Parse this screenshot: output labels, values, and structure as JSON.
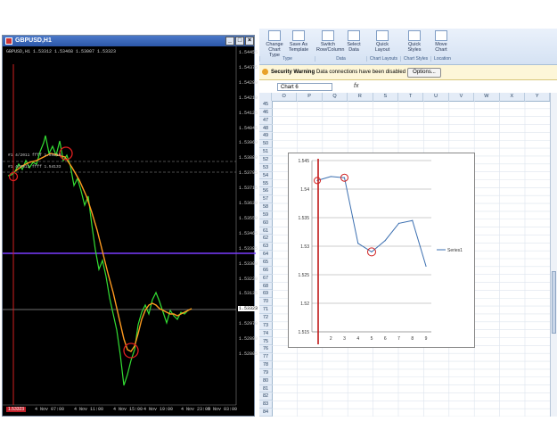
{
  "terminal": {
    "window_title": "GBPUSD,H1",
    "quote_line": "GBPUSD,H1 1.53312 1.53468 1.53007 1.53323",
    "price_labels": [
      "1.54455",
      "1.54290",
      "1.54125",
      "1.53960",
      "1.53795",
      "1.53630",
      "1.53465",
      "1.53300",
      "1.53135",
      "1.52970",
      "1.52805",
      "1.52640",
      "1.52475",
      "1.52310",
      "1.52145",
      "1.51980"
    ],
    "price_labels_display": [
      "1.54455",
      "1.54375",
      "1.54290",
      "1.54210",
      "1.54125",
      "1.54045",
      "1.53960",
      "1.53880",
      "1.53795",
      "1.53715",
      "1.53630",
      "1.53550",
      "1.53465",
      "1.53385",
      "1.53300",
      "1.53220",
      "1.53135",
      "1.53055",
      "1.52970",
      "1.52890",
      "1.52805"
    ],
    "time_labels": [
      "4 Nov 07:00",
      "4 Nov 11:00",
      "4 Nov 15:00",
      "4 Nov 19:00",
      "4 Nov 23:00",
      "5 Nov 03:00"
    ],
    "hline_labels": [
      "#1 4/2011 ffff 1.54210",
      "#1 4/2011 ffff 1.54133"
    ],
    "current_price": "1.53323",
    "bottom_tag": "1.53323",
    "colors": {
      "fast_line": "#33dd33",
      "slow_line": "#ff9a1f",
      "purple_line": "#7a3cff",
      "marker": "#e02020"
    }
  },
  "excel": {
    "ribbon": {
      "buttons": [
        {
          "label": "Change Chart Type",
          "icon": "change-chart-type-icon"
        },
        {
          "label": "Save As Template",
          "icon": "save-template-icon"
        },
        {
          "label": "Switch Row/Column",
          "icon": "switch-row-column-icon"
        },
        {
          "label": "Select Data",
          "icon": "select-data-icon"
        },
        {
          "label": "Quick Layout",
          "icon": "quick-layout-icon"
        },
        {
          "label": "Quick Styles",
          "icon": "quick-styles-icon"
        },
        {
          "label": "Move Chart",
          "icon": "move-chart-icon"
        }
      ],
      "groups": [
        "Type",
        "Data",
        "Chart Layouts",
        "Chart Styles",
        "Location"
      ]
    },
    "security": {
      "title": "Security Warning",
      "message": "Data connections have been disabled",
      "options_label": "Options..."
    },
    "name_box": "Chart 6",
    "fx_label": "fx",
    "columns": [
      "O",
      "P",
      "Q",
      "R",
      "S",
      "T",
      "U",
      "V",
      "W",
      "X",
      "Y"
    ],
    "rows": [
      "45",
      "46",
      "47",
      "48",
      "49",
      "50",
      "51",
      "52",
      "53",
      "54",
      "55",
      "56",
      "57",
      "58",
      "59",
      "60",
      "61",
      "62",
      "63",
      "64",
      "65",
      "66",
      "67",
      "68",
      "69",
      "70",
      "71",
      "72",
      "73",
      "74",
      "75",
      "76",
      "77",
      "78",
      "79",
      "80",
      "81",
      "82",
      "83",
      "84"
    ]
  },
  "chart_data": {
    "type": "line",
    "x": [
      1,
      2,
      3,
      4,
      5,
      6,
      7,
      8,
      9
    ],
    "series": [
      {
        "name": "Series1",
        "values": [
          1.5415,
          1.5422,
          1.542,
          1.5305,
          1.529,
          1.531,
          1.534,
          1.5345,
          1.5265
        ]
      }
    ],
    "ylim": [
      1.515,
      1.545
    ],
    "yticks": [
      "1.545",
      "1.54",
      "1.535",
      "1.53",
      "1.525",
      "1.52",
      "1.515"
    ],
    "xticks": [
      "2",
      "3",
      "4",
      "5",
      "6",
      "7",
      "8",
      "9"
    ],
    "legend": "right",
    "grid": true
  }
}
